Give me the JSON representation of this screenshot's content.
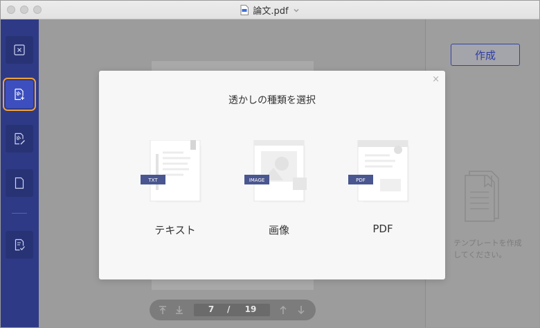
{
  "window": {
    "title": "論文.pdf"
  },
  "sidebar": {
    "items": [
      {
        "name": "close-watermark",
        "icon": "close-square-icon"
      },
      {
        "name": "add-watermark",
        "icon": "add-watermark-icon",
        "active": true
      },
      {
        "name": "edit-watermark",
        "icon": "edit-watermark-icon"
      },
      {
        "name": "blank-page",
        "icon": "page-icon"
      },
      {
        "name": "apply",
        "icon": "apply-check-icon"
      }
    ]
  },
  "pagenav": {
    "current": "7",
    "separator": "/",
    "total": "19"
  },
  "rightpanel": {
    "create_label": "作成",
    "empty_text": "テンプレートを作成してください。"
  },
  "modal": {
    "title": "透かしの種類を選択",
    "close": "×",
    "options": [
      {
        "label": "テキスト",
        "badge": "TXT"
      },
      {
        "label": "画像",
        "badge": "IMAGE"
      },
      {
        "label": "PDF",
        "badge": "PDF"
      }
    ]
  },
  "colors": {
    "sidebar": "#2f3a86",
    "accent": "#3d4fbf",
    "highlight": "#f0a23a",
    "badge": "#4a5690"
  }
}
